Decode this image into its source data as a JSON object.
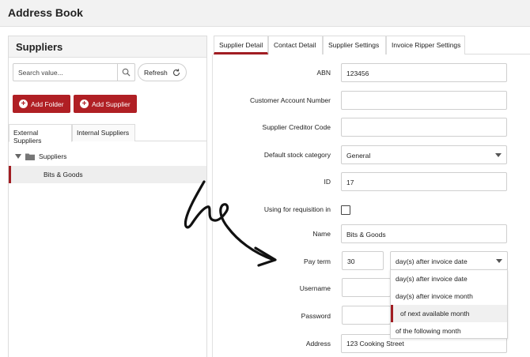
{
  "app": {
    "title": "Address Book"
  },
  "left_panel": {
    "title": "Suppliers",
    "search": {
      "placeholder": "Search value..."
    },
    "refresh_label": "Refresh",
    "add_folder_label": "Add Folder",
    "add_supplier_label": "Add Supplier",
    "tabs": [
      {
        "label": "External Suppliers",
        "active": true
      },
      {
        "label": "Internal Suppliers",
        "active": false
      }
    ],
    "tree": {
      "root_label": "Suppliers",
      "items": [
        {
          "label": "Bits & Goods",
          "selected": true
        }
      ]
    }
  },
  "right_panel": {
    "tabs": [
      {
        "label": "Supplier Detail",
        "active": true
      },
      {
        "label": "Contact Detail",
        "active": false
      },
      {
        "label": "Supplier Settings",
        "active": false
      },
      {
        "label": "Invoice Ripper Settings",
        "active": false
      }
    ],
    "fields": {
      "abn": {
        "label": "ABN",
        "value": "123456"
      },
      "customer_account_number": {
        "label": "Customer Account Number",
        "value": ""
      },
      "supplier_creditor_code": {
        "label": "Supplier Creditor Code",
        "value": ""
      },
      "default_stock_category": {
        "label": "Default stock category",
        "value": "General"
      },
      "id": {
        "label": "ID",
        "value": "17"
      },
      "using_for_requisition": {
        "label": "Using for requisition in",
        "checked": false
      },
      "name": {
        "label": "Name",
        "value": "Bits & Goods"
      },
      "pay_term": {
        "label": "Pay term",
        "value": "30",
        "unit": "day(s) after invoice date"
      },
      "username": {
        "label": "Username",
        "value": ""
      },
      "password": {
        "label": "Password",
        "value": ""
      },
      "address": {
        "label": "Address",
        "value": "123 Cooking Street"
      }
    },
    "pay_term_options": [
      "day(s) after invoice date",
      "day(s) after invoice month",
      "of next available month",
      "of the following month"
    ],
    "highlighted_option_index": 2
  },
  "colors": {
    "accent": "#a11d22",
    "button_red": "#b01f24"
  },
  "icons": {
    "search": "search-icon",
    "refresh": "refresh-icon",
    "plus": "plus-circle-icon",
    "folder": "folder-icon",
    "caret": "chevron-down-icon",
    "arrow": "hand-drawn-arrow-annotation"
  }
}
